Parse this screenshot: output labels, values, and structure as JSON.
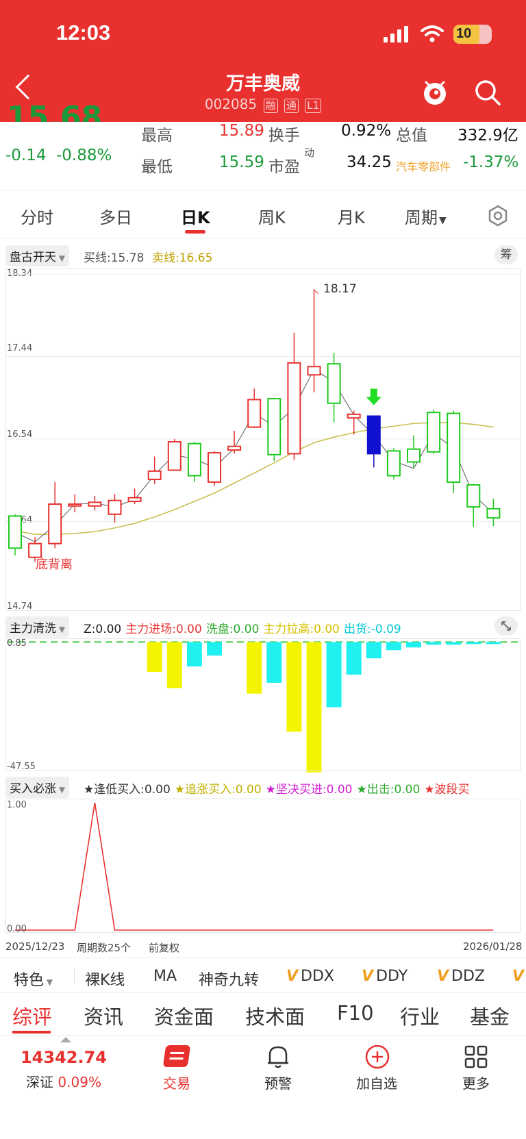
{
  "status_bar": {
    "time": "12:03",
    "battery": "10"
  },
  "header": {
    "stock_name": "万丰奥威",
    "stock_code": "002085",
    "tags": [
      "融",
      "通",
      "L1"
    ]
  },
  "quote": {
    "price_partial": "15.68",
    "change": "-0.14",
    "change_pct": "-0.88%",
    "high_label": "最高",
    "high": "15.89",
    "low_label": "最低",
    "low": "15.59",
    "turnover_label": "换手",
    "turnover": "0.92%",
    "pe_label": "市盈",
    "pe_sup": "动",
    "pe": "34.25",
    "mktcap_label": "总值",
    "mktcap": "332.9亿",
    "sector": "汽车零部件",
    "sector_change": "-1.37%"
  },
  "tabs": [
    "分时",
    "多日",
    "日K",
    "周K",
    "月K",
    "周期"
  ],
  "active_tab": "日K",
  "kline": {
    "indicator": "盘古开天",
    "buy_line": "买线:15.78",
    "sell_line": "卖线:16.65",
    "chip_btn": "筹",
    "levels": [
      "18.34",
      "17.44",
      "16.54",
      "15.64",
      "14.74"
    ],
    "high_marker": "18.17",
    "annotation": "底背离"
  },
  "zhuli": {
    "indicator": "主力清洗",
    "items": [
      {
        "text": "Z:0.00",
        "color": "#222222"
      },
      {
        "text": "主力进场:0.00",
        "color": "#e8312f"
      },
      {
        "text": "洗盘:0.00",
        "color": "#2aa82a"
      },
      {
        "text": "主力拉高:0.00",
        "color": "#d8c000"
      },
      {
        "text": "出货:-0.09",
        "color": "#00c8d8"
      }
    ],
    "levels": [
      "0.85",
      "-47.55"
    ]
  },
  "buy": {
    "indicator": "买入必涨",
    "items": [
      {
        "text": "★逢低买入:0.00",
        "color": "#333333"
      },
      {
        "text": "★追涨买入:0.00",
        "color": "#c0b000"
      },
      {
        "text": "★坚决买进:0.00",
        "color": "#d020d0"
      },
      {
        "text": "★出击:0.00",
        "color": "#2aa82a"
      },
      {
        "text": "★波段买",
        "color": "#e8312f"
      }
    ],
    "levels": [
      "1.00",
      "0.00"
    ]
  },
  "date_row": {
    "start": "2025/12/23",
    "period": "周期数25个",
    "adjust": "前复权",
    "end": "2026/01/28"
  },
  "indicator_bar": {
    "special": "特色",
    "items": [
      "裸K线",
      "MA",
      "神奇九转",
      "DDX",
      "DDY",
      "DDZ"
    ],
    "v_mark": "V"
  },
  "info_tabs": [
    "综评",
    "资讯",
    "资金面",
    "技术面",
    "F10",
    "行业",
    "基金"
  ],
  "footer": {
    "index_value": "14342.74",
    "index_name": "深证",
    "index_change": "0.09%",
    "trade": "交易",
    "alert": "预警",
    "add": "加自选",
    "more": "更多"
  },
  "chart_data": [
    {
      "type": "candlestick",
      "title": "日K",
      "y_range": [
        14.74,
        18.34
      ],
      "candles": [
        {
          "o": 15.7,
          "c": 15.35,
          "h": 15.72,
          "l": 15.27
        },
        {
          "o": 15.25,
          "c": 15.4,
          "h": 15.47,
          "l": 15.2
        },
        {
          "o": 15.4,
          "c": 15.83,
          "h": 16.07,
          "l": 15.35
        },
        {
          "o": 15.81,
          "c": 15.83,
          "h": 15.94,
          "l": 15.74
        },
        {
          "o": 15.81,
          "c": 15.85,
          "h": 15.92,
          "l": 15.76
        },
        {
          "o": 15.72,
          "c": 15.87,
          "h": 15.94,
          "l": 15.63
        },
        {
          "o": 15.86,
          "c": 15.9,
          "h": 16.0,
          "l": 15.83
        },
        {
          "o": 16.1,
          "c": 16.19,
          "h": 16.35,
          "l": 16.05
        },
        {
          "o": 16.2,
          "c": 16.51,
          "h": 16.54,
          "l": 16.2
        },
        {
          "o": 16.49,
          "c": 16.14,
          "h": 16.51,
          "l": 16.07
        },
        {
          "o": 16.07,
          "c": 16.39,
          "h": 16.41,
          "l": 16.03
        },
        {
          "o": 16.42,
          "c": 16.46,
          "h": 16.63,
          "l": 16.38
        },
        {
          "o": 16.67,
          "c": 16.97,
          "h": 17.09,
          "l": 16.66
        },
        {
          "o": 16.98,
          "c": 16.37,
          "h": 16.99,
          "l": 16.3
        },
        {
          "o": 16.38,
          "c": 17.37,
          "h": 17.7,
          "l": 16.31
        },
        {
          "o": 17.24,
          "c": 17.33,
          "h": 18.17,
          "l": 17.05
        },
        {
          "o": 17.36,
          "c": 16.93,
          "h": 17.48,
          "l": 16.72
        },
        {
          "o": 16.77,
          "c": 16.81,
          "h": 16.85,
          "l": 16.59
        },
        {
          "o": 16.79,
          "c": 16.38,
          "h": 16.79,
          "l": 16.23,
          "color": "blue"
        },
        {
          "o": 16.41,
          "c": 16.14,
          "h": 16.44,
          "l": 16.1
        },
        {
          "o": 16.43,
          "c": 16.29,
          "h": 16.58,
          "l": 16.23
        },
        {
          "o": 16.83,
          "c": 16.4,
          "h": 16.86,
          "l": 16.38
        },
        {
          "o": 16.82,
          "c": 16.07,
          "h": 16.85,
          "l": 15.95
        },
        {
          "o": 16.04,
          "c": 15.8,
          "h": 16.05,
          "l": 15.58
        },
        {
          "o": 15.78,
          "c": 15.68,
          "h": 15.89,
          "l": 15.59
        }
      ],
      "annotations": [
        {
          "index": 15,
          "value": 18.17,
          "text": "18.17"
        },
        {
          "index": 18,
          "type": "down-arrow"
        }
      ],
      "line_series": [
        {
          "values": [
            15.54,
            15.5,
            15.5,
            15.51,
            15.53,
            15.57,
            15.62,
            15.69,
            15.77,
            15.86,
            15.95,
            16.06,
            16.17,
            16.28,
            16.4,
            16.5,
            16.56,
            16.61,
            16.65,
            16.68,
            16.71,
            16.72,
            16.72,
            16.7,
            16.67
          ],
          "color": "#c8c050"
        },
        {
          "values": [
            15.52,
            15.42,
            15.6,
            15.83,
            15.84,
            15.8,
            15.88,
            16.15,
            16.37,
            16.32,
            16.23,
            16.44,
            16.82,
            16.68,
            16.88,
            17.3,
            17.16,
            16.8,
            16.58,
            16.3,
            16.22,
            16.6,
            16.44,
            15.93,
            15.73
          ],
          "color": "#707070"
        }
      ]
    },
    {
      "type": "bar",
      "title": "主力清洗",
      "y_range": [
        -47.55,
        0.85
      ],
      "series": [
        {
          "name": "主力拉高",
          "color": "#f4f400",
          "values": [
            0,
            0,
            0,
            0,
            0,
            0,
            0,
            -11,
            -17,
            0,
            0,
            0,
            -19,
            0,
            -33,
            -48,
            0,
            0,
            0,
            0,
            0,
            0,
            0,
            0,
            0
          ]
        },
        {
          "name": "出货",
          "color": "#20f0f0",
          "values": [
            0,
            0,
            0,
            0,
            0,
            0,
            0,
            0,
            0,
            -9,
            -5,
            0,
            0,
            -15,
            0,
            0,
            -24,
            -12,
            -6,
            -3,
            -2,
            -1,
            -1,
            -0.5,
            -0.1
          ]
        }
      ]
    },
    {
      "type": "line",
      "title": "买入必涨",
      "y_range": [
        0,
        1
      ],
      "series": [
        {
          "name": "逢低买入",
          "color": "#e8312f",
          "values": [
            0,
            0,
            0,
            0,
            1,
            0,
            0,
            0,
            0,
            0,
            0,
            0,
            0,
            0,
            0,
            0,
            0,
            0,
            0,
            0,
            0,
            0,
            0,
            0,
            0
          ]
        }
      ]
    }
  ]
}
